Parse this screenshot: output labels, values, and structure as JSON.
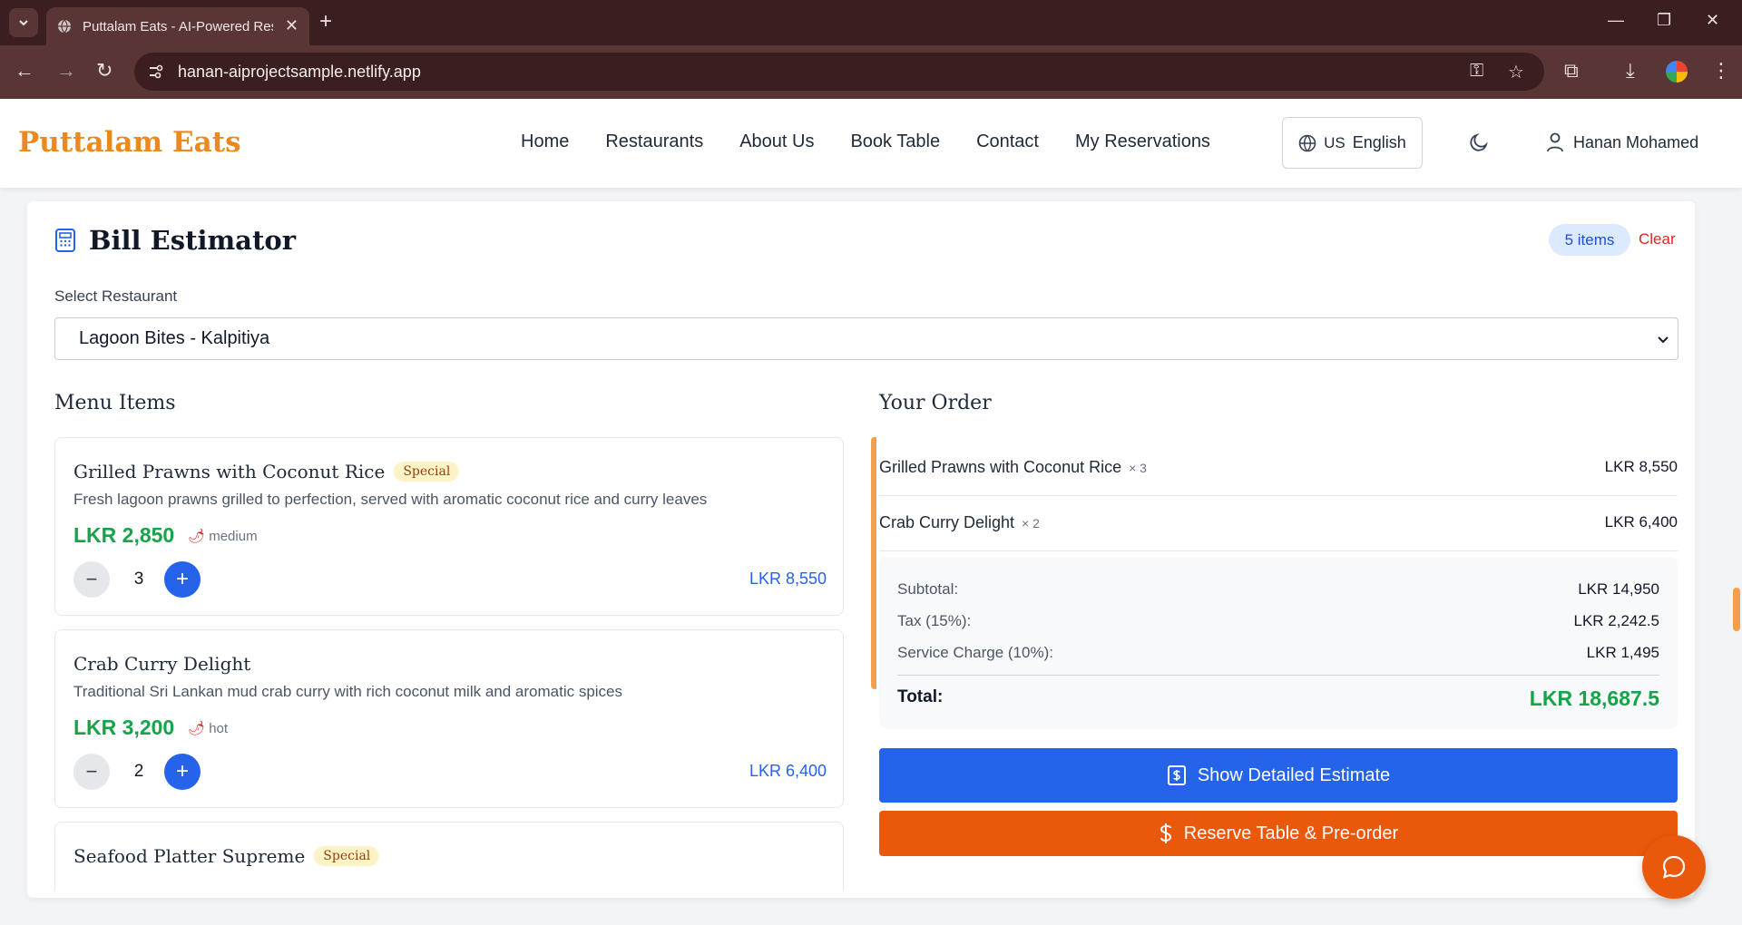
{
  "browser": {
    "tab_title": "Puttalam Eats - AI-Powered Res",
    "url": "hanan-aiprojectsample.netlify.app",
    "new_tab_icon": "plus",
    "tab_close_icon": "close"
  },
  "header": {
    "logo": "Puttalam Eats",
    "nav": [
      "Home",
      "Restaurants",
      "About Us",
      "Book Table",
      "Contact",
      "My Reservations"
    ],
    "language": {
      "code": "US",
      "label": "English"
    },
    "user_name": "Hanan Mohamed"
  },
  "estimator": {
    "title": "Bill Estimator",
    "items_badge": "5 items",
    "clear_label": "Clear",
    "select_label": "Select Restaurant",
    "selected_restaurant": "Lagoon Bites - Kalpitiya"
  },
  "menu": {
    "heading": "Menu Items",
    "items": [
      {
        "name": "Grilled Prawns with Coconut Rice",
        "badge": "Special",
        "description": "Fresh lagoon prawns grilled to perfection, served with aromatic coconut rice and curry leaves",
        "price": "LKR 2,850",
        "spice": "medium",
        "qty": "3",
        "line_total": "LKR 8,550"
      },
      {
        "name": "Crab Curry Delight",
        "badge": "",
        "description": "Traditional Sri Lankan mud crab curry with rich coconut milk and aromatic spices",
        "price": "LKR 3,200",
        "spice": "hot",
        "qty": "2",
        "line_total": "LKR 6,400"
      },
      {
        "name": "Seafood Platter Supreme",
        "badge": "Special"
      }
    ]
  },
  "order": {
    "heading": "Your Order",
    "items": [
      {
        "name": "Grilled Prawns with Coconut Rice",
        "qty": "× 3",
        "price": "LKR 8,550"
      },
      {
        "name": "Crab Curry Delight",
        "qty": "× 2",
        "price": "LKR 6,400"
      }
    ],
    "subtotal_label": "Subtotal:",
    "subtotal": "LKR 14,950",
    "tax_label": "Tax (15%):",
    "tax": "LKR 2,242.5",
    "service_label": "Service Charge (10%):",
    "service": "LKR 1,495",
    "total_label": "Total:",
    "total": "LKR 18,687.5",
    "detail_button": "Show Detailed Estimate",
    "reserve_button": "Reserve Table & Pre-order"
  },
  "colors": {
    "brand_orange": "#ea8a1e",
    "primary_blue": "#2563eb",
    "accent_orange": "#ea580c",
    "price_green": "#16a34a"
  }
}
